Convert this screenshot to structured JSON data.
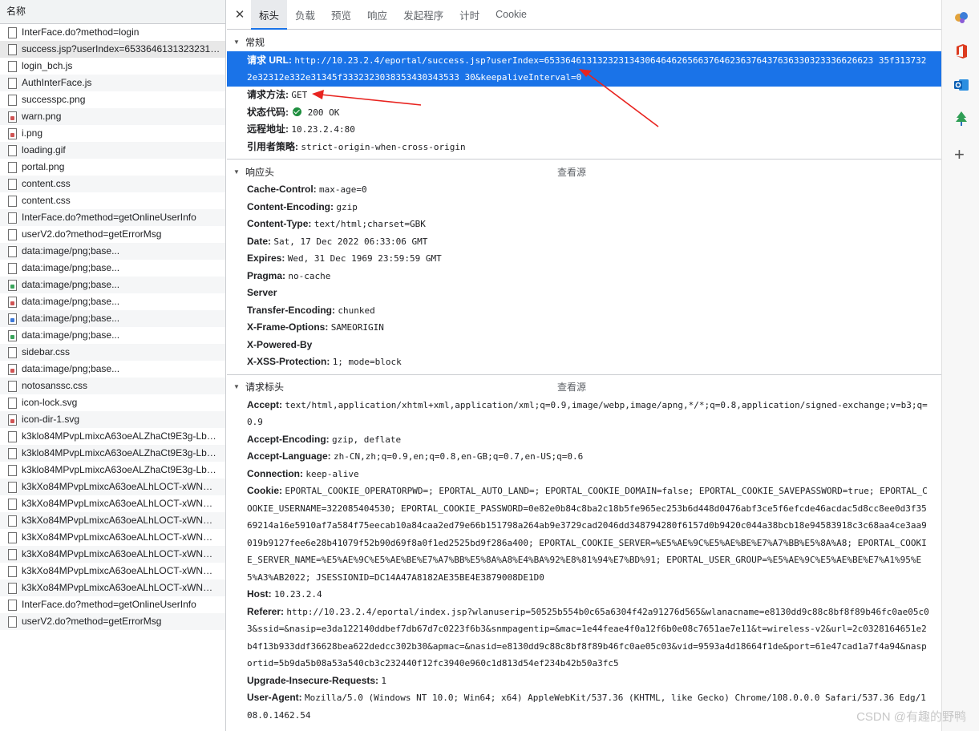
{
  "request_list": {
    "header": "名称",
    "items": [
      {
        "name": "InterFace.do?method=login",
        "icon": "doc"
      },
      {
        "name": "success.jsp?userIndex=653364613132323134...",
        "icon": "doc",
        "selected": true
      },
      {
        "name": "login_bch.js",
        "icon": "doc"
      },
      {
        "name": "AuthInterFace.js",
        "icon": "doc"
      },
      {
        "name": "successpc.png",
        "icon": "doc"
      },
      {
        "name": "warn.png",
        "icon": "img"
      },
      {
        "name": "i.png",
        "icon": "img"
      },
      {
        "name": "loading.gif",
        "icon": "doc"
      },
      {
        "name": "portal.png",
        "icon": "doc"
      },
      {
        "name": "content.css",
        "icon": "doc"
      },
      {
        "name": "content.css",
        "icon": "doc"
      },
      {
        "name": "InterFace.do?method=getOnlineUserInfo",
        "icon": "doc"
      },
      {
        "name": "userV2.do?method=getErrorMsg",
        "icon": "doc"
      },
      {
        "name": "data:image/png;base...",
        "icon": "doc"
      },
      {
        "name": "data:image/png;base...",
        "icon": "doc"
      },
      {
        "name": "data:image/png;base...",
        "icon": "img-g"
      },
      {
        "name": "data:image/png;base...",
        "icon": "img"
      },
      {
        "name": "data:image/png;base...",
        "icon": "img-b"
      },
      {
        "name": "data:image/png;base...",
        "icon": "img-g"
      },
      {
        "name": "sidebar.css",
        "icon": "doc"
      },
      {
        "name": "data:image/png;base...",
        "icon": "img"
      },
      {
        "name": "notosanssc.css",
        "icon": "doc"
      },
      {
        "name": "icon-lock.svg",
        "icon": "doc"
      },
      {
        "name": "icon-dir-1.svg",
        "icon": "img"
      },
      {
        "name": "k3klo84MPvpLmixcA63oeALZhaCt9E3g-Lbpc...",
        "icon": "doc"
      },
      {
        "name": "k3klo84MPvpLmixcA63oeALZhaCt9E3g-Lbpc...",
        "icon": "doc"
      },
      {
        "name": "k3klo84MPvpLmixcA63oeALZhaCt9E3g-Lbpc...",
        "icon": "doc"
      },
      {
        "name": "k3kXo84MPvpLmixcA63oeALhLOCT-xWNm8...",
        "icon": "doc"
      },
      {
        "name": "k3kXo84MPvpLmixcA63oeALhLOCT-xWNm8...",
        "icon": "doc"
      },
      {
        "name": "k3kXo84MPvpLmixcA63oeALhLOCT-xWNm8...",
        "icon": "doc"
      },
      {
        "name": "k3kXo84MPvpLmixcA63oeALhLOCT-xWNm8...",
        "icon": "doc"
      },
      {
        "name": "k3kXo84MPvpLmixcA63oeALhLOCT-xWNm8...",
        "icon": "doc"
      },
      {
        "name": "k3kXo84MPvpLmixcA63oeALhLOCT-xWNm8...",
        "icon": "doc"
      },
      {
        "name": "k3kXo84MPvpLmixcA63oeALhLOCT-xWNm8...",
        "icon": "doc"
      },
      {
        "name": "InterFace.do?method=getOnlineUserInfo",
        "icon": "doc"
      },
      {
        "name": "userV2.do?method=getErrorMsg",
        "icon": "doc"
      }
    ]
  },
  "tabs": {
    "close_icon": "✕",
    "items": [
      "标头",
      "负载",
      "预览",
      "响应",
      "发起程序",
      "计时",
      "Cookie"
    ],
    "active_index": 0
  },
  "general": {
    "title": "常规",
    "request_url_key": "请求 URL:",
    "request_url_value": "http://10.23.2.4/eportal/success.jsp?userIndex=65336461313232313430646462656637646236376437636330323336626623 35f3137322e32312e332e31345f3332323038353430343533 30&keepaliveInterval=0",
    "method_key": "请求方法:",
    "method_value": "GET",
    "status_key": "状态代码:",
    "status_value": "200 OK",
    "remote_key": "远程地址:",
    "remote_value": "10.23.2.4:80",
    "referrer_key": "引用者策略:",
    "referrer_value": "strict-origin-when-cross-origin"
  },
  "response_headers": {
    "title": "响应头",
    "view_source": "查看源",
    "rows": [
      {
        "k": "Cache-Control:",
        "v": "max-age=0"
      },
      {
        "k": "Content-Encoding:",
        "v": "gzip"
      },
      {
        "k": "Content-Type:",
        "v": "text/html;charset=GBK"
      },
      {
        "k": "Date:",
        "v": "Sat, 17 Dec 2022 06:33:06 GMT"
      },
      {
        "k": "Expires:",
        "v": "Wed, 31 Dec 1969 23:59:59 GMT"
      },
      {
        "k": "Pragma:",
        "v": "no-cache"
      },
      {
        "k": "Server",
        "v": ""
      },
      {
        "k": "Transfer-Encoding:",
        "v": "chunked"
      },
      {
        "k": "X-Frame-Options:",
        "v": "SAMEORIGIN"
      },
      {
        "k": "X-Powered-By",
        "v": ""
      },
      {
        "k": "X-XSS-Protection:",
        "v": "1; mode=block"
      }
    ]
  },
  "request_headers": {
    "title": "请求标头",
    "view_source": "查看源",
    "rows": [
      {
        "k": "Accept:",
        "v": "text/html,application/xhtml+xml,application/xml;q=0.9,image/webp,image/apng,*/*;q=0.8,application/signed-exchange;v=b3;q=0.9"
      },
      {
        "k": "Accept-Encoding:",
        "v": "gzip, deflate"
      },
      {
        "k": "Accept-Language:",
        "v": "zh-CN,zh;q=0.9,en;q=0.8,en-GB;q=0.7,en-US;q=0.6"
      },
      {
        "k": "Connection:",
        "v": "keep-alive"
      },
      {
        "k": "Cookie:",
        "v": "EPORTAL_COOKIE_OPERATORPWD=; EPORTAL_AUTO_LAND=; EPORTAL_COOKIE_DOMAIN=false; EPORTAL_COOKIE_SAVEPASSWORD=true; EPORTAL_COOKIE_USERNAME=322085404530; EPORTAL_COOKIE_PASSWORD=0e82e0b84c8ba2c18b5fe965ec253b6d448d0476abf3ce5f6efcde46acdac5d8cc8ee0d3f3569214a16e5910af7a584f75eecab10a84caa2ed79e66b151798a264ab9e3729cad2046dd348794280f6157d0b9420c044a38bcb18e94583918c3c68aa4ce3aa9019b9127fee6e28b41079f52b90d69f8a0f1ed2525bd9f286a400; EPORTAL_COOKIE_SERVER=%E5%AE%9C%E5%AE%BE%E7%A7%BB%E5%8A%A8; EPORTAL_COOKIE_SERVER_NAME=%E5%AE%9C%E5%AE%BE%E7%A7%BB%E5%8A%A8%E4%BA%92%E8%81%94%E7%BD%91; EPORTAL_USER_GROUP=%E5%AE%9C%E5%AE%BE%E7%A1%95%E5%A3%AB2022; JSESSIONID=DC14A47A8182AE35BE4E3879008DE1D0"
      },
      {
        "k": "Host:",
        "v": "10.23.2.4"
      },
      {
        "k": "Referer:",
        "v": "http://10.23.2.4/eportal/index.jsp?wlanuserip=50525b554b0c65a6304f42a91276d565&wlanacname=e8130dd9c88c8bf8f89b46fc0ae05c03&ssid=&nasip=e3da122140ddbef7db67d7c0223f6b3&snmpagentip=&mac=1e44feae4f0a12f6b0e08c7651ae7e11&t=wireless-v2&url=2c0328164651e2b4f13b933ddf36628bea622dedcc302b30&apmac=&nasid=e8130dd9c88c8bf8f89b46fc0ae05c03&vid=9593a4d18664f1de&port=61e47cad1a7f4a94&nasportid=5b9da5b08a53a540cb3c232440f12fc3940e960c1d813d54ef234b42b50a3fc5"
      },
      {
        "k": "Upgrade-Insecure-Requests:",
        "v": "1"
      },
      {
        "k": "User-Agent:",
        "v": "Mozilla/5.0 (Windows NT 10.0; Win64; x64) AppleWebKit/537.36 (KHTML, like Gecko) Chrome/108.0.0.0 Safari/537.36 Edg/108.0.1462.54"
      }
    ]
  },
  "side_bar": {
    "icons": [
      "extensions-icon",
      "office-icon",
      "outlook-icon",
      "tree-icon"
    ],
    "plus_label": "+"
  },
  "watermark": "CSDN @有趣的野鸭",
  "colors": {
    "accent": "#1a73e8",
    "arrow": "#e8231f",
    "status_ok": "#1e8e3e"
  }
}
